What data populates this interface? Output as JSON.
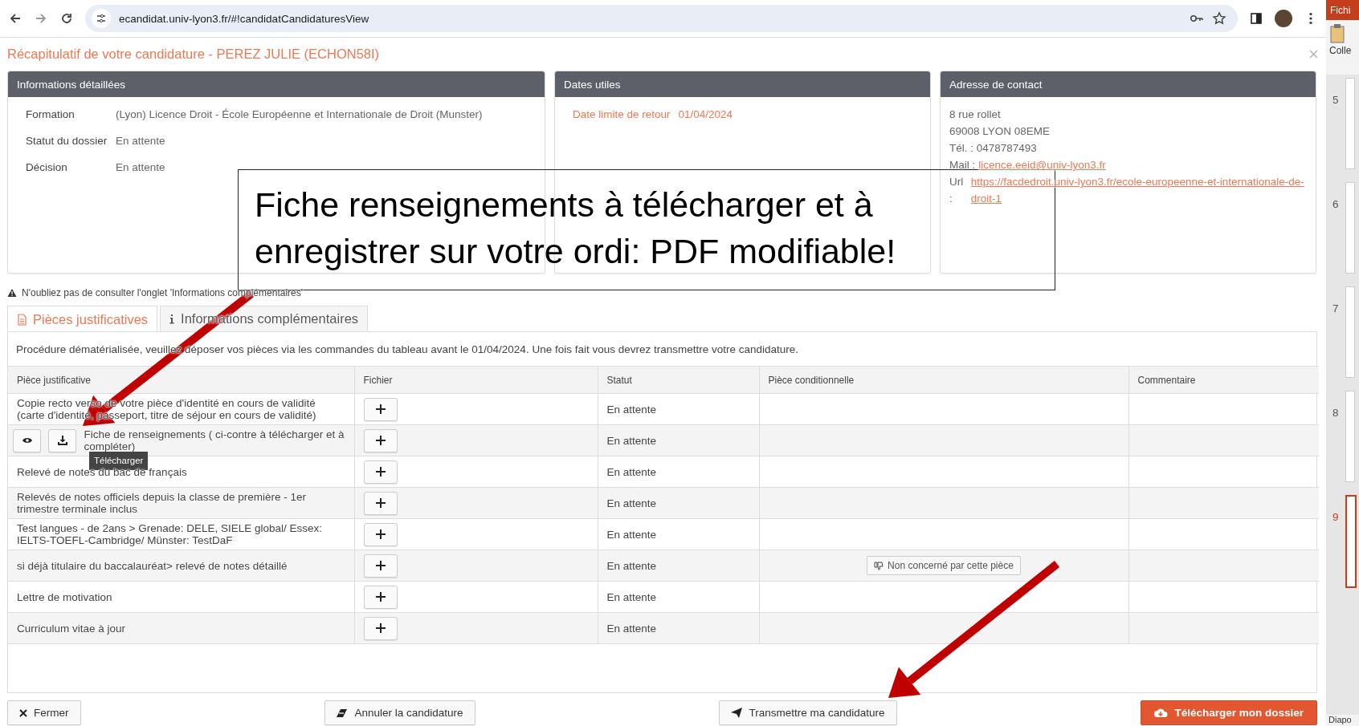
{
  "browser": {
    "url": "ecandidat.univ-lyon3.fr/#!candidatCandidaturesView"
  },
  "page_title": "Récapitulatif de votre candidature - PEREZ JULIE (ECHON58I)",
  "panels": [
    {
      "kind": "fields",
      "title": "Informations détaillées",
      "fields": [
        {
          "label": "Formation",
          "value": "(Lyon) Licence Droit - École Européenne et Internationale de Droit (Munster)"
        },
        {
          "label": "Statut du dossier",
          "value": "En attente"
        },
        {
          "label": "Décision",
          "value": "En attente"
        }
      ]
    },
    {
      "kind": "dates",
      "title": "Dates utiles",
      "fields": [
        {
          "label": "Date limite de retour",
          "value": "01/04/2024"
        }
      ]
    },
    {
      "kind": "address",
      "title": "Adresse de contact",
      "lines": [
        "8 rue rollet",
        "69008 LYON 08EME",
        "Tél. : 0478787493"
      ],
      "links": [
        {
          "label": "Mail :",
          "value": "licence.eeid@univ-lyon3.fr"
        },
        {
          "label": "Url :",
          "value": "https://facdedroit.univ-lyon3.fr/ecole-europeenne-et-internationale-de-droit-1"
        }
      ]
    }
  ],
  "notice": "N'oubliez pas de consulter l'onglet 'Informations complémentaires'",
  "tabs": [
    {
      "label": "Pièces justificatives",
      "selected": true
    },
    {
      "label": "Informations complémentaires",
      "selected": false
    }
  ],
  "intro": "Procédure dématérialisée, veuillez déposer vos pièces via les commandes du tableau avant le 01/04/2024. Une fois fait vous devrez transmettre votre candidature.",
  "table": {
    "columns": [
      "Pièce justificative",
      "Fichier",
      "Statut",
      "Pièce conditionnelle",
      "Commentaire"
    ],
    "rows": [
      {
        "kind": "plain",
        "piece": "Copie recto verso de votre pièce d'identité en cours de validité (carte d'identité, passeport, titre de séjour en cours de validité)",
        "status": "En attente"
      },
      {
        "kind": "template",
        "piece": "Fiche de renseignements ( ci-contre à télécharger et à compléter)",
        "status": "En attente",
        "tooltip": "Télécharger"
      },
      {
        "kind": "plain",
        "piece": "Relevé de notes du bac de français",
        "status": "En attente"
      },
      {
        "kind": "plain",
        "piece": "Relevés de notes officiels depuis la classe de première - 1er trimestre terminale inclus",
        "status": "En attente"
      },
      {
        "kind": "plain",
        "piece": "Test langues - de 2ans > Grenade: DELE, SIELE global/ Essex: IELTS-TOEFL-Cambridge/ Münster: TestDaF",
        "status": "En attente"
      },
      {
        "kind": "conditional",
        "piece": "si déjà titulaire du baccalauréat> relevé de notes détaillé",
        "status": "En attente",
        "conditional": "Non concerné par cette pièce"
      },
      {
        "kind": "plain",
        "piece": "Lettre de motivation",
        "status": "En attente"
      },
      {
        "kind": "plain",
        "piece": "Curriculum vitae à jour",
        "status": "En attente"
      }
    ]
  },
  "buttons": [
    {
      "kind": "close",
      "label": "Fermer"
    },
    {
      "kind": "cancel",
      "label": "Annuler la candidature"
    },
    {
      "kind": "submit",
      "label": "Transmettre ma candidature"
    },
    {
      "kind": "download",
      "label": "Télécharger mon dossier"
    }
  ],
  "side_panel": {
    "tab": "Fichi",
    "button": "Colle",
    "slides": [
      {
        "label": "5",
        "selected": false
      },
      {
        "label": "6",
        "selected": false
      },
      {
        "label": "7",
        "selected": false
      },
      {
        "label": "8",
        "selected": false
      },
      {
        "label": "9",
        "selected": true
      }
    ],
    "status": "Diapo"
  },
  "annotation": {
    "text": "Fiche renseignements à télécharger et à enregistrer sur votre ordi: PDF modifiable!"
  }
}
